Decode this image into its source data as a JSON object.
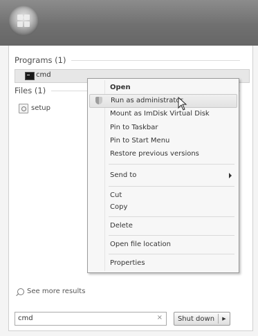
{
  "start_menu": {
    "programs_header": "Programs (1)",
    "programs": [
      {
        "label": "cmd",
        "icon": "cmd-icon"
      }
    ],
    "files_header": "Files (1)",
    "files": [
      {
        "label": "setup",
        "icon": "setup-icon"
      }
    ],
    "see_more": "See more results",
    "search_value": "cmd",
    "clear_glyph": "×",
    "shutdown_label": "Shut down",
    "shutdown_arrow": "▶"
  },
  "context_menu": {
    "open": "Open",
    "run_as_admin": "Run as administrator",
    "mount_imdisk": "Mount as ImDisk Virtual Disk",
    "pin_taskbar": "Pin to Taskbar",
    "pin_start": "Pin to Start Menu",
    "restore_versions": "Restore previous versions",
    "send_to": "Send to",
    "cut": "Cut",
    "copy": "Copy",
    "delete": "Delete",
    "open_location": "Open file location",
    "properties": "Properties"
  },
  "colors": {
    "highlight": "#e2e2e2",
    "topbar": "#707070"
  }
}
